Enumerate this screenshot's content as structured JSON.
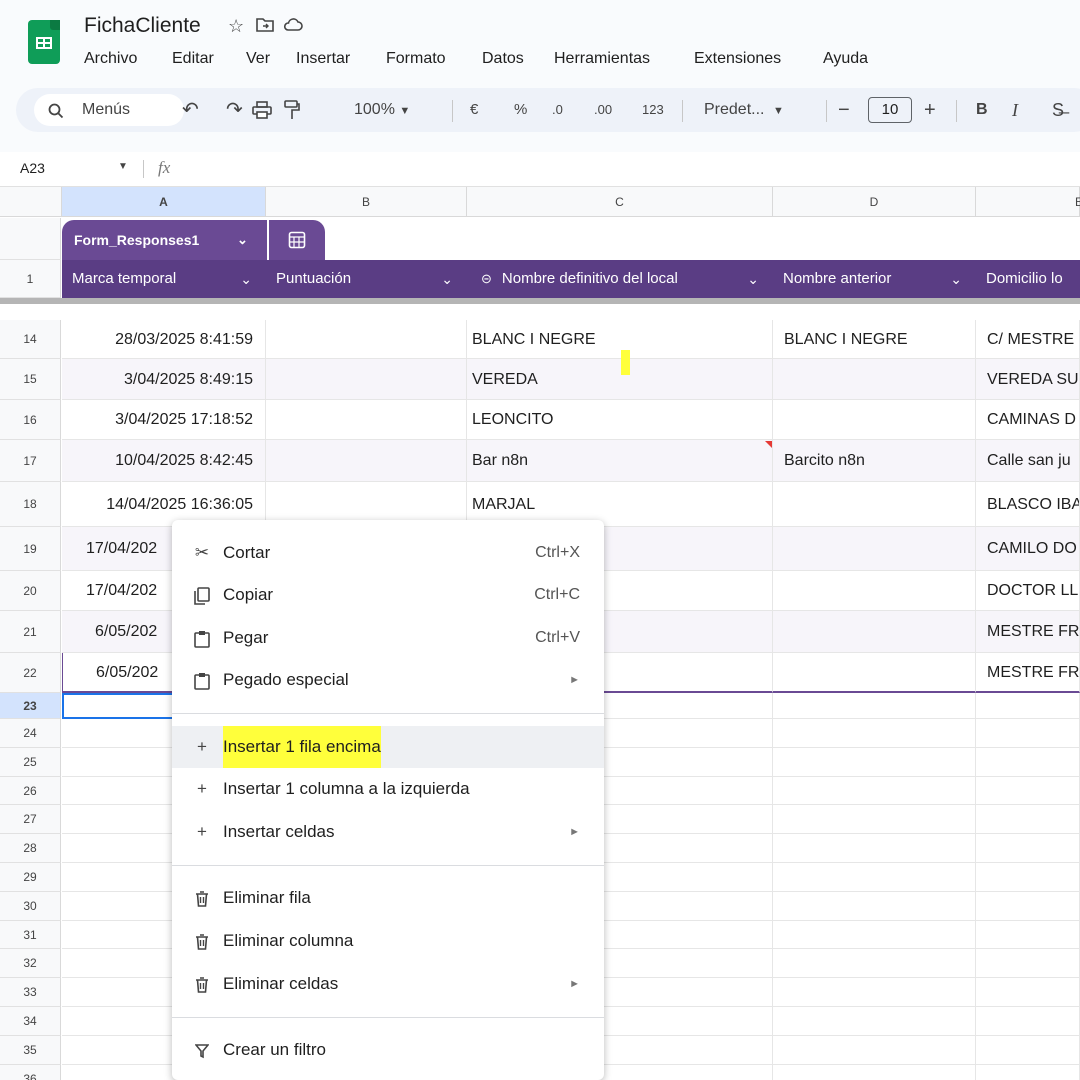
{
  "app": {
    "title": "FichaCliente",
    "title_icons": [
      "star-icon",
      "move-to-folder-icon",
      "cloud-status-icon"
    ],
    "menu": [
      "Archivo",
      "Editar",
      "Ver",
      "Insertar",
      "Formato",
      "Datos",
      "Herramientas",
      "Extensiones",
      "Ayuda"
    ]
  },
  "toolbar": {
    "search_label": "Menús",
    "zoom": "100%",
    "currency": "€",
    "percent": "%",
    "decrease_decimals": ".0",
    "increase_decimals": ".00",
    "number_format": "123",
    "font": "Predet...",
    "font_size": "10",
    "minus": "−",
    "plus": "+",
    "bold": "B",
    "italic": "I"
  },
  "formula_bar": {
    "cell_ref": "A23",
    "fx": "fx"
  },
  "columns": [
    "A",
    "B",
    "C",
    "D",
    "E"
  ],
  "table": {
    "name": "Form_Responses1",
    "headers": [
      "Marca temporal",
      "Puntuación",
      "Nombre definitivo del local",
      "Nombre anterior",
      "Domicilio lo"
    ],
    "header_row_number": "1"
  },
  "rows": [
    {
      "num": "14",
      "a": "28/03/2025 8:41:59",
      "c": "BLANC I NEGRE",
      "d": "BLANC I NEGRE",
      "e": "C/ MESTRE"
    },
    {
      "num": "15",
      "a": "3/04/2025 8:49:15",
      "c": "VEREDA",
      "d": "",
      "e": "VEREDA SU"
    },
    {
      "num": "16",
      "a": "3/04/2025 17:18:52",
      "c": "LEONCITO",
      "d": "",
      "e": "CAMINAS D"
    },
    {
      "num": "17",
      "a": "10/04/2025 8:42:45",
      "c": "Bar n8n",
      "d": "Barcito n8n",
      "e": "Calle san ju"
    },
    {
      "num": "18",
      "a": "14/04/2025 16:36:05",
      "c": "MARJAL",
      "d": "",
      "e": "BLASCO IBA"
    },
    {
      "num": "19",
      "a": "17/04/202",
      "c": "",
      "d": "",
      "e": "CAMILO DO"
    },
    {
      "num": "20",
      "a": "17/04/202",
      "c": "",
      "d": "",
      "e": "DOCTOR LL"
    },
    {
      "num": "21",
      "a": "6/05/202",
      "c": "",
      "d": "",
      "e": "MESTRE FR"
    },
    {
      "num": "22",
      "a": "6/05/202",
      "c": "",
      "d": "",
      "e": "MESTRE FR"
    }
  ],
  "empty_rows": [
    "23",
    "24",
    "25",
    "26",
    "27",
    "28",
    "29",
    "30",
    "31",
    "32",
    "33",
    "34",
    "35",
    "36"
  ],
  "context_menu": {
    "cut": {
      "label": "Cortar",
      "shortcut": "Ctrl+X"
    },
    "copy": {
      "label": "Copiar",
      "shortcut": "Ctrl+C"
    },
    "paste": {
      "label": "Pegar",
      "shortcut": "Ctrl+V"
    },
    "paste_special": {
      "label": "Pegado especial"
    },
    "insert_row_above": {
      "label": "Insertar 1 fila encima"
    },
    "insert_col_left": {
      "label": "Insertar 1 columna a la izquierda"
    },
    "insert_cells": {
      "label": "Insertar celdas"
    },
    "delete_row": {
      "label": "Eliminar fila"
    },
    "delete_column": {
      "label": "Eliminar columna"
    },
    "delete_cells": {
      "label": "Eliminar celdas"
    },
    "create_filter": {
      "label": "Crear un filtro"
    }
  },
  "colors": {
    "table_header": "#5a3d84",
    "highlight": "#ffff3b",
    "sheets_green": "#0f9d58"
  }
}
